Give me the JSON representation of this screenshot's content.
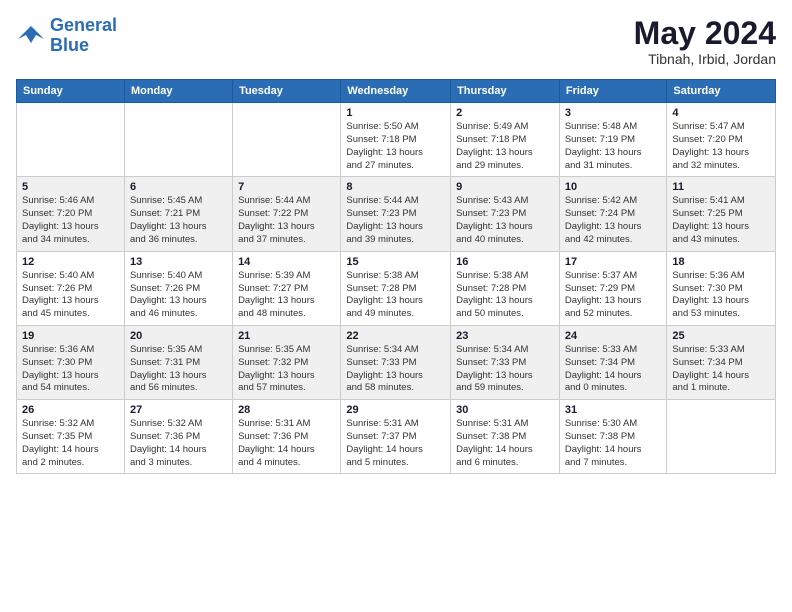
{
  "app": {
    "name": "GeneralBlue",
    "name_part1": "General",
    "name_part2": "Blue"
  },
  "header": {
    "month_title": "May 2024",
    "location": "Tibnah, Irbid, Jordan"
  },
  "weekdays": [
    "Sunday",
    "Monday",
    "Tuesday",
    "Wednesday",
    "Thursday",
    "Friday",
    "Saturday"
  ],
  "weeks": [
    {
      "row_class": "row-odd",
      "days": [
        {
          "num": "",
          "info": ""
        },
        {
          "num": "",
          "info": ""
        },
        {
          "num": "",
          "info": ""
        },
        {
          "num": "1",
          "info": "Sunrise: 5:50 AM\nSunset: 7:18 PM\nDaylight: 13 hours\nand 27 minutes."
        },
        {
          "num": "2",
          "info": "Sunrise: 5:49 AM\nSunset: 7:18 PM\nDaylight: 13 hours\nand 29 minutes."
        },
        {
          "num": "3",
          "info": "Sunrise: 5:48 AM\nSunset: 7:19 PM\nDaylight: 13 hours\nand 31 minutes."
        },
        {
          "num": "4",
          "info": "Sunrise: 5:47 AM\nSunset: 7:20 PM\nDaylight: 13 hours\nand 32 minutes."
        }
      ]
    },
    {
      "row_class": "row-even",
      "days": [
        {
          "num": "5",
          "info": "Sunrise: 5:46 AM\nSunset: 7:20 PM\nDaylight: 13 hours\nand 34 minutes."
        },
        {
          "num": "6",
          "info": "Sunrise: 5:45 AM\nSunset: 7:21 PM\nDaylight: 13 hours\nand 36 minutes."
        },
        {
          "num": "7",
          "info": "Sunrise: 5:44 AM\nSunset: 7:22 PM\nDaylight: 13 hours\nand 37 minutes."
        },
        {
          "num": "8",
          "info": "Sunrise: 5:44 AM\nSunset: 7:23 PM\nDaylight: 13 hours\nand 39 minutes."
        },
        {
          "num": "9",
          "info": "Sunrise: 5:43 AM\nSunset: 7:23 PM\nDaylight: 13 hours\nand 40 minutes."
        },
        {
          "num": "10",
          "info": "Sunrise: 5:42 AM\nSunset: 7:24 PM\nDaylight: 13 hours\nand 42 minutes."
        },
        {
          "num": "11",
          "info": "Sunrise: 5:41 AM\nSunset: 7:25 PM\nDaylight: 13 hours\nand 43 minutes."
        }
      ]
    },
    {
      "row_class": "row-odd",
      "days": [
        {
          "num": "12",
          "info": "Sunrise: 5:40 AM\nSunset: 7:26 PM\nDaylight: 13 hours\nand 45 minutes."
        },
        {
          "num": "13",
          "info": "Sunrise: 5:40 AM\nSunset: 7:26 PM\nDaylight: 13 hours\nand 46 minutes."
        },
        {
          "num": "14",
          "info": "Sunrise: 5:39 AM\nSunset: 7:27 PM\nDaylight: 13 hours\nand 48 minutes."
        },
        {
          "num": "15",
          "info": "Sunrise: 5:38 AM\nSunset: 7:28 PM\nDaylight: 13 hours\nand 49 minutes."
        },
        {
          "num": "16",
          "info": "Sunrise: 5:38 AM\nSunset: 7:28 PM\nDaylight: 13 hours\nand 50 minutes."
        },
        {
          "num": "17",
          "info": "Sunrise: 5:37 AM\nSunset: 7:29 PM\nDaylight: 13 hours\nand 52 minutes."
        },
        {
          "num": "18",
          "info": "Sunrise: 5:36 AM\nSunset: 7:30 PM\nDaylight: 13 hours\nand 53 minutes."
        }
      ]
    },
    {
      "row_class": "row-even",
      "days": [
        {
          "num": "19",
          "info": "Sunrise: 5:36 AM\nSunset: 7:30 PM\nDaylight: 13 hours\nand 54 minutes."
        },
        {
          "num": "20",
          "info": "Sunrise: 5:35 AM\nSunset: 7:31 PM\nDaylight: 13 hours\nand 56 minutes."
        },
        {
          "num": "21",
          "info": "Sunrise: 5:35 AM\nSunset: 7:32 PM\nDaylight: 13 hours\nand 57 minutes."
        },
        {
          "num": "22",
          "info": "Sunrise: 5:34 AM\nSunset: 7:33 PM\nDaylight: 13 hours\nand 58 minutes."
        },
        {
          "num": "23",
          "info": "Sunrise: 5:34 AM\nSunset: 7:33 PM\nDaylight: 13 hours\nand 59 minutes."
        },
        {
          "num": "24",
          "info": "Sunrise: 5:33 AM\nSunset: 7:34 PM\nDaylight: 14 hours\nand 0 minutes."
        },
        {
          "num": "25",
          "info": "Sunrise: 5:33 AM\nSunset: 7:34 PM\nDaylight: 14 hours\nand 1 minute."
        }
      ]
    },
    {
      "row_class": "row-odd",
      "days": [
        {
          "num": "26",
          "info": "Sunrise: 5:32 AM\nSunset: 7:35 PM\nDaylight: 14 hours\nand 2 minutes."
        },
        {
          "num": "27",
          "info": "Sunrise: 5:32 AM\nSunset: 7:36 PM\nDaylight: 14 hours\nand 3 minutes."
        },
        {
          "num": "28",
          "info": "Sunrise: 5:31 AM\nSunset: 7:36 PM\nDaylight: 14 hours\nand 4 minutes."
        },
        {
          "num": "29",
          "info": "Sunrise: 5:31 AM\nSunset: 7:37 PM\nDaylight: 14 hours\nand 5 minutes."
        },
        {
          "num": "30",
          "info": "Sunrise: 5:31 AM\nSunset: 7:38 PM\nDaylight: 14 hours\nand 6 minutes."
        },
        {
          "num": "31",
          "info": "Sunrise: 5:30 AM\nSunset: 7:38 PM\nDaylight: 14 hours\nand 7 minutes."
        },
        {
          "num": "",
          "info": ""
        }
      ]
    }
  ]
}
